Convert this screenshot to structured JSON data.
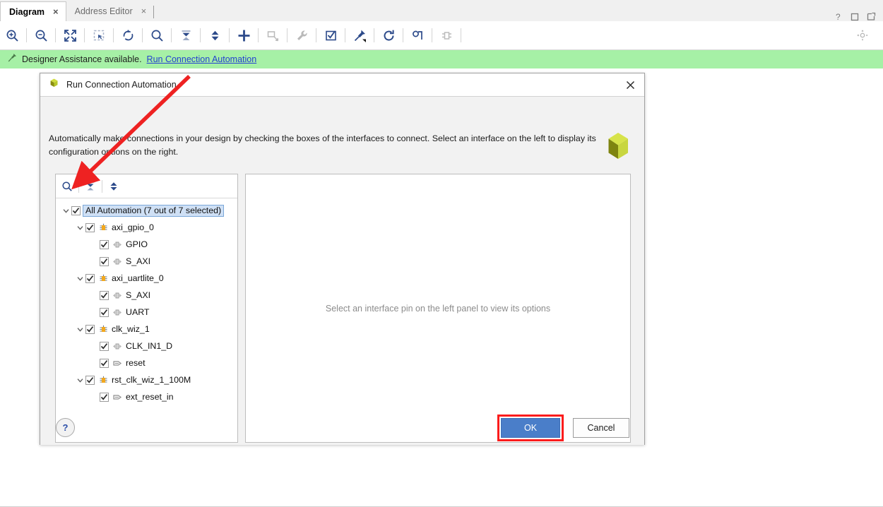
{
  "window": {
    "tabs": [
      {
        "label": "Diagram",
        "close": "×",
        "active": true
      },
      {
        "label": "Address Editor",
        "close": "×",
        "active": false
      }
    ],
    "controls": [
      {
        "name": "help-icon",
        "glyph": "?"
      },
      {
        "name": "maximize-icon",
        "glyph": "□"
      },
      {
        "name": "float-window-icon",
        "glyph": "↗"
      }
    ]
  },
  "toolbar": {
    "buttons": [
      {
        "name": "zoom-in-icon",
        "title": "Zoom In"
      },
      {
        "name": "zoom-out-icon",
        "title": "Zoom Out"
      },
      {
        "name": "zoom-fit-icon",
        "title": "Zoom Fit"
      },
      {
        "name": "zoom-area-icon",
        "title": "Zoom Area"
      },
      {
        "name": "fit-selection-icon",
        "title": "Fit Selection"
      },
      {
        "name": "search-icon",
        "title": "Search"
      },
      {
        "name": "collapse-all-icon",
        "title": "Collapse All"
      },
      {
        "name": "expand-all-icon",
        "title": "Expand All"
      },
      {
        "name": "add-ip-icon",
        "title": "Add IP"
      },
      {
        "name": "add-module-icon",
        "title": "Add Module"
      },
      {
        "name": "settings-wrench-icon",
        "title": "Block Design Settings"
      },
      {
        "name": "validate-design-icon",
        "title": "Validate Design"
      },
      {
        "name": "pin-icon",
        "title": "Pin"
      },
      {
        "name": "regenerate-layout-icon",
        "title": "Regenerate Layout"
      },
      {
        "name": "optimize-routing-icon",
        "title": "Optimize Routing"
      },
      {
        "name": "hierarchy-icon",
        "title": "Hierarchy"
      }
    ],
    "gear": {
      "name": "gear-icon",
      "title": "Settings"
    }
  },
  "assistance": {
    "icon": "pin-icon",
    "text": "Designer Assistance available.",
    "link": "Run Connection Automation"
  },
  "dialog": {
    "title": "Run Connection Automation",
    "close_glyph": "✕",
    "description": "Automatically make connections in your design by checking the boxes of the interfaces to connect. Select an interface on the left to display its configuration options on the right.",
    "tree_toolbar": [
      {
        "name": "tree-search-icon",
        "title": "Search"
      },
      {
        "name": "tree-collapse-all-icon",
        "title": "Collapse All"
      },
      {
        "name": "tree-expand-all-icon",
        "title": "Expand All"
      }
    ],
    "tree": [
      {
        "label": "All Automation (7 out of 7 selected)",
        "indent": 0,
        "twisty": "down",
        "checked": true,
        "icon": "none",
        "selected": true
      },
      {
        "label": "axi_gpio_0",
        "indent": 1,
        "twisty": "down",
        "checked": true,
        "icon": "ip-block-icon",
        "selected": false
      },
      {
        "label": "GPIO",
        "indent": 2,
        "twisty": "none",
        "checked": true,
        "icon": "interface-pin-icon",
        "selected": false
      },
      {
        "label": "S_AXI",
        "indent": 2,
        "twisty": "none",
        "checked": true,
        "icon": "interface-pin-icon",
        "selected": false
      },
      {
        "label": "axi_uartlite_0",
        "indent": 1,
        "twisty": "down",
        "checked": true,
        "icon": "ip-block-icon",
        "selected": false
      },
      {
        "label": "S_AXI",
        "indent": 2,
        "twisty": "none",
        "checked": true,
        "icon": "interface-pin-icon",
        "selected": false
      },
      {
        "label": "UART",
        "indent": 2,
        "twisty": "none",
        "checked": true,
        "icon": "interface-pin-icon",
        "selected": false
      },
      {
        "label": "clk_wiz_1",
        "indent": 1,
        "twisty": "down",
        "checked": true,
        "icon": "ip-block-icon",
        "selected": false
      },
      {
        "label": "CLK_IN1_D",
        "indent": 2,
        "twisty": "none",
        "checked": true,
        "icon": "interface-pin-icon",
        "selected": false
      },
      {
        "label": "reset",
        "indent": 2,
        "twisty": "none",
        "checked": true,
        "icon": "signal-pin-icon",
        "selected": false
      },
      {
        "label": "rst_clk_wiz_1_100M",
        "indent": 1,
        "twisty": "down",
        "checked": true,
        "icon": "ip-block-icon",
        "selected": false
      },
      {
        "label": "ext_reset_in",
        "indent": 2,
        "twisty": "none",
        "checked": true,
        "icon": "signal-pin-icon",
        "selected": false
      }
    ],
    "right_panel_message": "Select an interface pin on the left panel to view its options",
    "help_label": "?",
    "ok_label": "OK",
    "cancel_label": "Cancel"
  },
  "colors": {
    "assistance_bg": "#a6f0a6",
    "link": "#2340d0",
    "ok_button": "#4a7ec9",
    "highlight_border": "#fb1c1c",
    "selection_bg": "#cfe0f5",
    "ip_block": "#f2a81e",
    "brand_logo": "#c3d72e",
    "annotation_arrow": "#ee2222"
  }
}
